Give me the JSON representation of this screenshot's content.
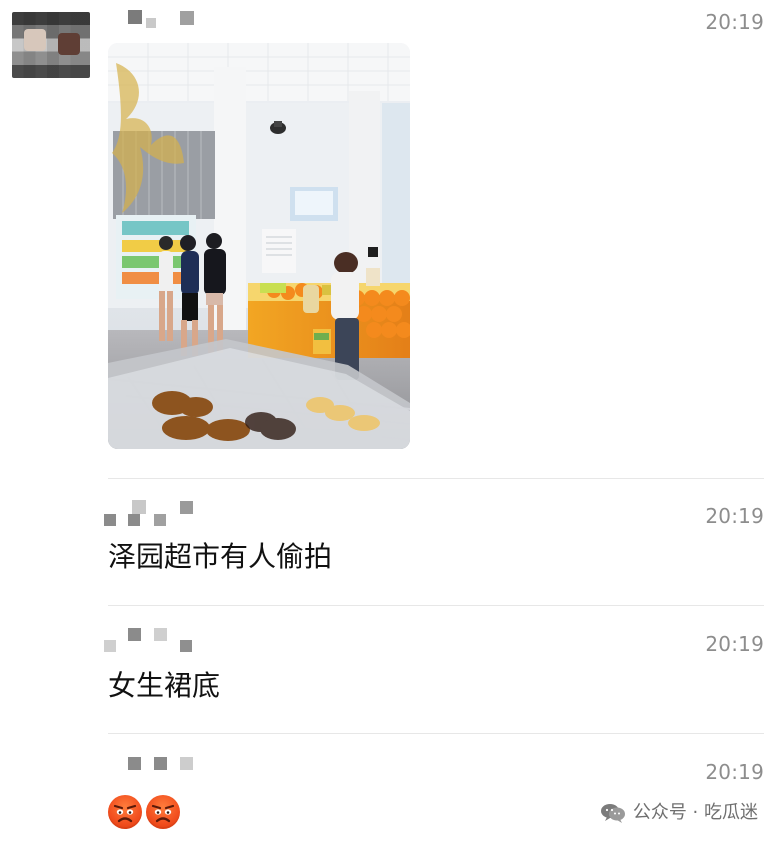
{
  "messages": [
    {
      "time": "20:19"
    },
    {
      "time": "20:19",
      "text": "泽园超市有人偷拍"
    },
    {
      "time": "20:19",
      "text": "女生裙底"
    },
    {
      "time": "20:19"
    }
  ],
  "watermark": {
    "text": "公众号 · 吃瓜迷"
  },
  "colors": {
    "timestamp": "#8d8d8d",
    "divider": "#e7e7e7",
    "emoji": "#f24f1f",
    "watermark": "#6f6f6f"
  },
  "icons": {
    "watermark": "wechat-icon",
    "reaction": "angry-face-icon"
  }
}
